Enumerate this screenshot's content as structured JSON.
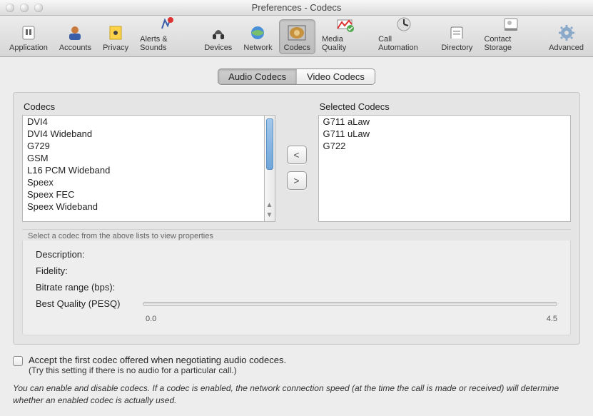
{
  "window": {
    "title": "Preferences - Codecs"
  },
  "toolbar": {
    "selected_index": 6,
    "items": [
      {
        "label": "Application"
      },
      {
        "label": "Accounts"
      },
      {
        "label": "Privacy"
      },
      {
        "label": "Alerts & Sounds"
      },
      {
        "label": "Devices"
      },
      {
        "label": "Network"
      },
      {
        "label": "Codecs"
      },
      {
        "label": "Media Quality"
      },
      {
        "label": "Call Automation"
      },
      {
        "label": "Directory"
      },
      {
        "label": "Contact Storage"
      },
      {
        "label": "Advanced"
      }
    ]
  },
  "tabs": {
    "selected_index": 0,
    "items": [
      {
        "label": "Audio Codecs"
      },
      {
        "label": "Video Codecs"
      }
    ]
  },
  "codecs": {
    "available_header": "Codecs",
    "selected_header": "Selected Codecs",
    "available": [
      "DVI4",
      "DVI4 Wideband",
      "G729",
      "GSM",
      "L16 PCM Wideband",
      "Speex",
      "Speex FEC",
      "Speex Wideband"
    ],
    "selected": [
      "G711 aLaw",
      "G711 uLaw",
      "G722"
    ],
    "move_left": "<",
    "move_right": ">",
    "hint": "Select a codec from the above lists to view properties"
  },
  "props": {
    "description_label": "Description:",
    "description_value": "",
    "fidelity_label": "Fidelity:",
    "fidelity_value": "",
    "bitrate_label": "Bitrate range (bps):",
    "bitrate_value": "",
    "quality_label": "Best Quality (PESQ)",
    "quality_min": "0.0",
    "quality_max": "4.5"
  },
  "accept": {
    "checked": false,
    "label": "Accept the first codec offered when negotiating audio codeces.",
    "hint": "(Try this setting if there is no audio for a particular call.)"
  },
  "note": "You can enable and disable codecs. If a codec is enabled, the network connection speed (at the time the call is made or received) will determine whether an enabled codec is actually used."
}
